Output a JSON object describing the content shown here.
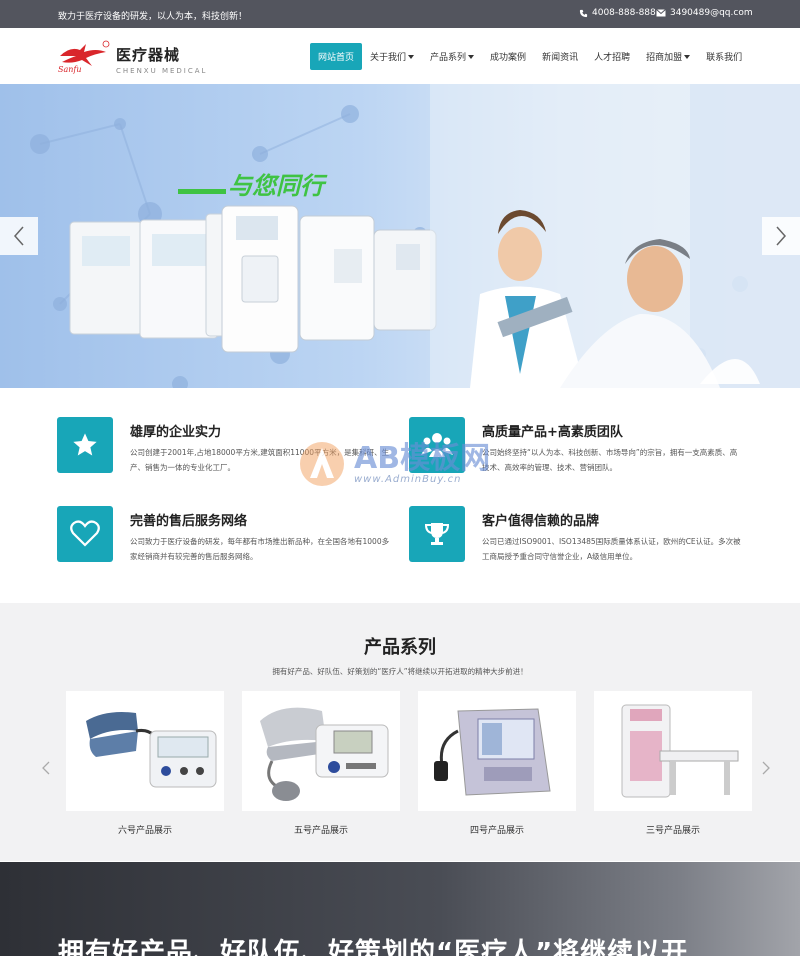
{
  "topbar": {
    "slogan": "致力于医疗设备的研发，以人为本，科技创新！",
    "phone": "4008-888-888",
    "email": "3490489@qq.com"
  },
  "header": {
    "logo_cn": "医疗器械",
    "logo_en": "CHENXU MEDICAL",
    "logo_script": "Sanfu",
    "nav": [
      {
        "label": "网站首页",
        "active": true,
        "dropdown": false
      },
      {
        "label": "关于我们",
        "active": false,
        "dropdown": true
      },
      {
        "label": "产品系列",
        "active": false,
        "dropdown": true
      },
      {
        "label": "成功案例",
        "active": false,
        "dropdown": false
      },
      {
        "label": "新闻资讯",
        "active": false,
        "dropdown": false
      },
      {
        "label": "人才招聘",
        "active": false,
        "dropdown": false
      },
      {
        "label": "招商加盟",
        "active": false,
        "dropdown": true
      },
      {
        "label": "联系我们",
        "active": false,
        "dropdown": false
      }
    ]
  },
  "banner": {
    "headline": "与您同行"
  },
  "features": [
    {
      "icon": "star-icon",
      "title": "雄厚的企业实力",
      "desc": "公司创建于2001年,占地18000平方米,建筑面积11000平方米，是集科研、生产、销售为一体的专业化工厂。"
    },
    {
      "icon": "team-icon",
      "title": "高质量产品+高素质团队",
      "desc": "公司始终坚持“以人为本、科技创新、市场导向”的宗旨，拥有一支高素质、高技术、高效率的管理、技术、营销团队。"
    },
    {
      "icon": "heart-icon",
      "title": "完善的售后服务网络",
      "desc": "公司致力于医疗设备的研发，每年都有市场推出新品种，在全国各地有1000多家经销商并有较完善的售后服务网络。"
    },
    {
      "icon": "trophy-icon",
      "title": "客户值得信赖的品牌",
      "desc": "公司已通过ISO9001、ISO13485国际质量体系认证，欧州的CE认证。多次被工商局授予重合同守信誉企业，A级信用单位。"
    }
  ],
  "watermark": {
    "brand": "AB模板网",
    "url": "www.AdminBuy.cn"
  },
  "products": {
    "title": "产品系列",
    "subtitle": "拥有好产品、好队伍、好策划的“医疗人”将继续以开拓进取的精神大步前进！",
    "items": [
      {
        "name": "六号产品展示"
      },
      {
        "name": "五号产品展示"
      },
      {
        "name": "四号产品展示"
      },
      {
        "name": "三号产品展示"
      }
    ]
  },
  "promo": {
    "headline": "拥有好产品、好队伍、好策划的“医疗人”将继续以开"
  },
  "colors": {
    "accent": "#18a6b8",
    "topbar": "#53555e"
  }
}
